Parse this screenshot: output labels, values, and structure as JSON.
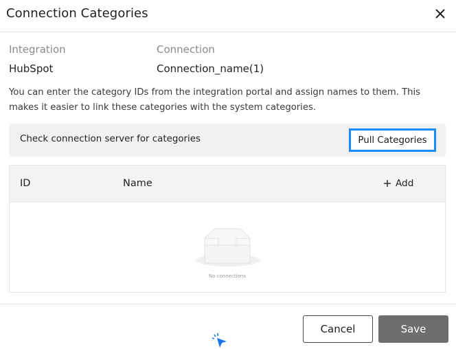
{
  "dialog": {
    "title": "Connection Categories"
  },
  "info": {
    "integration_label": "Integration",
    "integration_value": "HubSpot",
    "connection_label": "Connection",
    "connection_value": "Connection_name(1)"
  },
  "description": "You can enter the category IDs from the integration portal and assign names to them. This makes it easier to link these categories with the system categories.",
  "check_bar": {
    "text": "Check connection server for categories",
    "button_label": "Pull Categories"
  },
  "table": {
    "columns": [
      "ID",
      "Name"
    ],
    "add_label": "Add",
    "empty_text": "No connections",
    "rows": []
  },
  "footer": {
    "cancel_label": "Cancel",
    "save_label": "Save"
  },
  "icons": {
    "close": "close-icon",
    "add": "plus-icon",
    "empty": "empty-inbox-icon",
    "cursor": "pointer-cursor-icon"
  },
  "colors": {
    "focus_outline": "#1a8cff",
    "save_button": "#6e6e6e",
    "check_bar_bg": "#f1f1f1",
    "table_header_bg": "#f3f3f3"
  }
}
